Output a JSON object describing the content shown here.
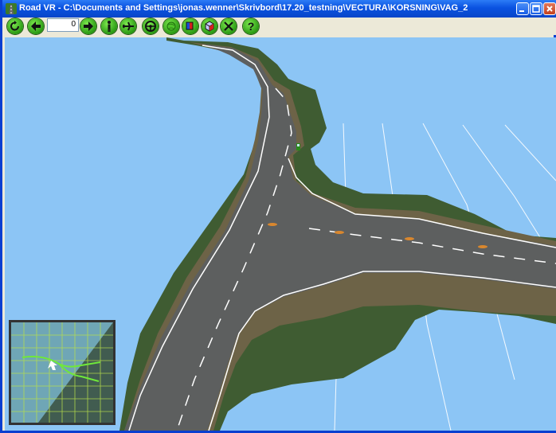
{
  "window": {
    "title": "Road VR - C:\\Documents and Settings\\jonas.wenner\\Skrivbord\\17.20_testning\\VECTURA\\KORSNING\\VAG_2"
  },
  "toolbar": {
    "frame_value": "0",
    "buttons": [
      {
        "name": "reset-view",
        "icon": "refresh-icon"
      },
      {
        "name": "step-back",
        "icon": "arrow-left-icon"
      },
      {
        "name": "step-forward",
        "icon": "arrow-right-icon"
      },
      {
        "name": "walk-mode",
        "icon": "person-icon"
      },
      {
        "name": "fly-mode",
        "icon": "airplane-icon"
      },
      {
        "name": "drive-mode",
        "icon": "steering-wheel-icon"
      },
      {
        "name": "terrain-toggle",
        "icon": "globe-icon"
      },
      {
        "name": "layers",
        "icon": "layers-icon"
      },
      {
        "name": "objects",
        "icon": "cube-icon"
      },
      {
        "name": "tools",
        "icon": "tools-icon"
      },
      {
        "name": "help",
        "icon": "help-icon"
      }
    ]
  },
  "colors": {
    "sky": "#8cc5f5",
    "road": "#5d5f5f",
    "shoulder": "#6d6347",
    "grass": "#3f5c32",
    "toolbar_button": "#3aa81c",
    "marker": "#d9872e"
  }
}
